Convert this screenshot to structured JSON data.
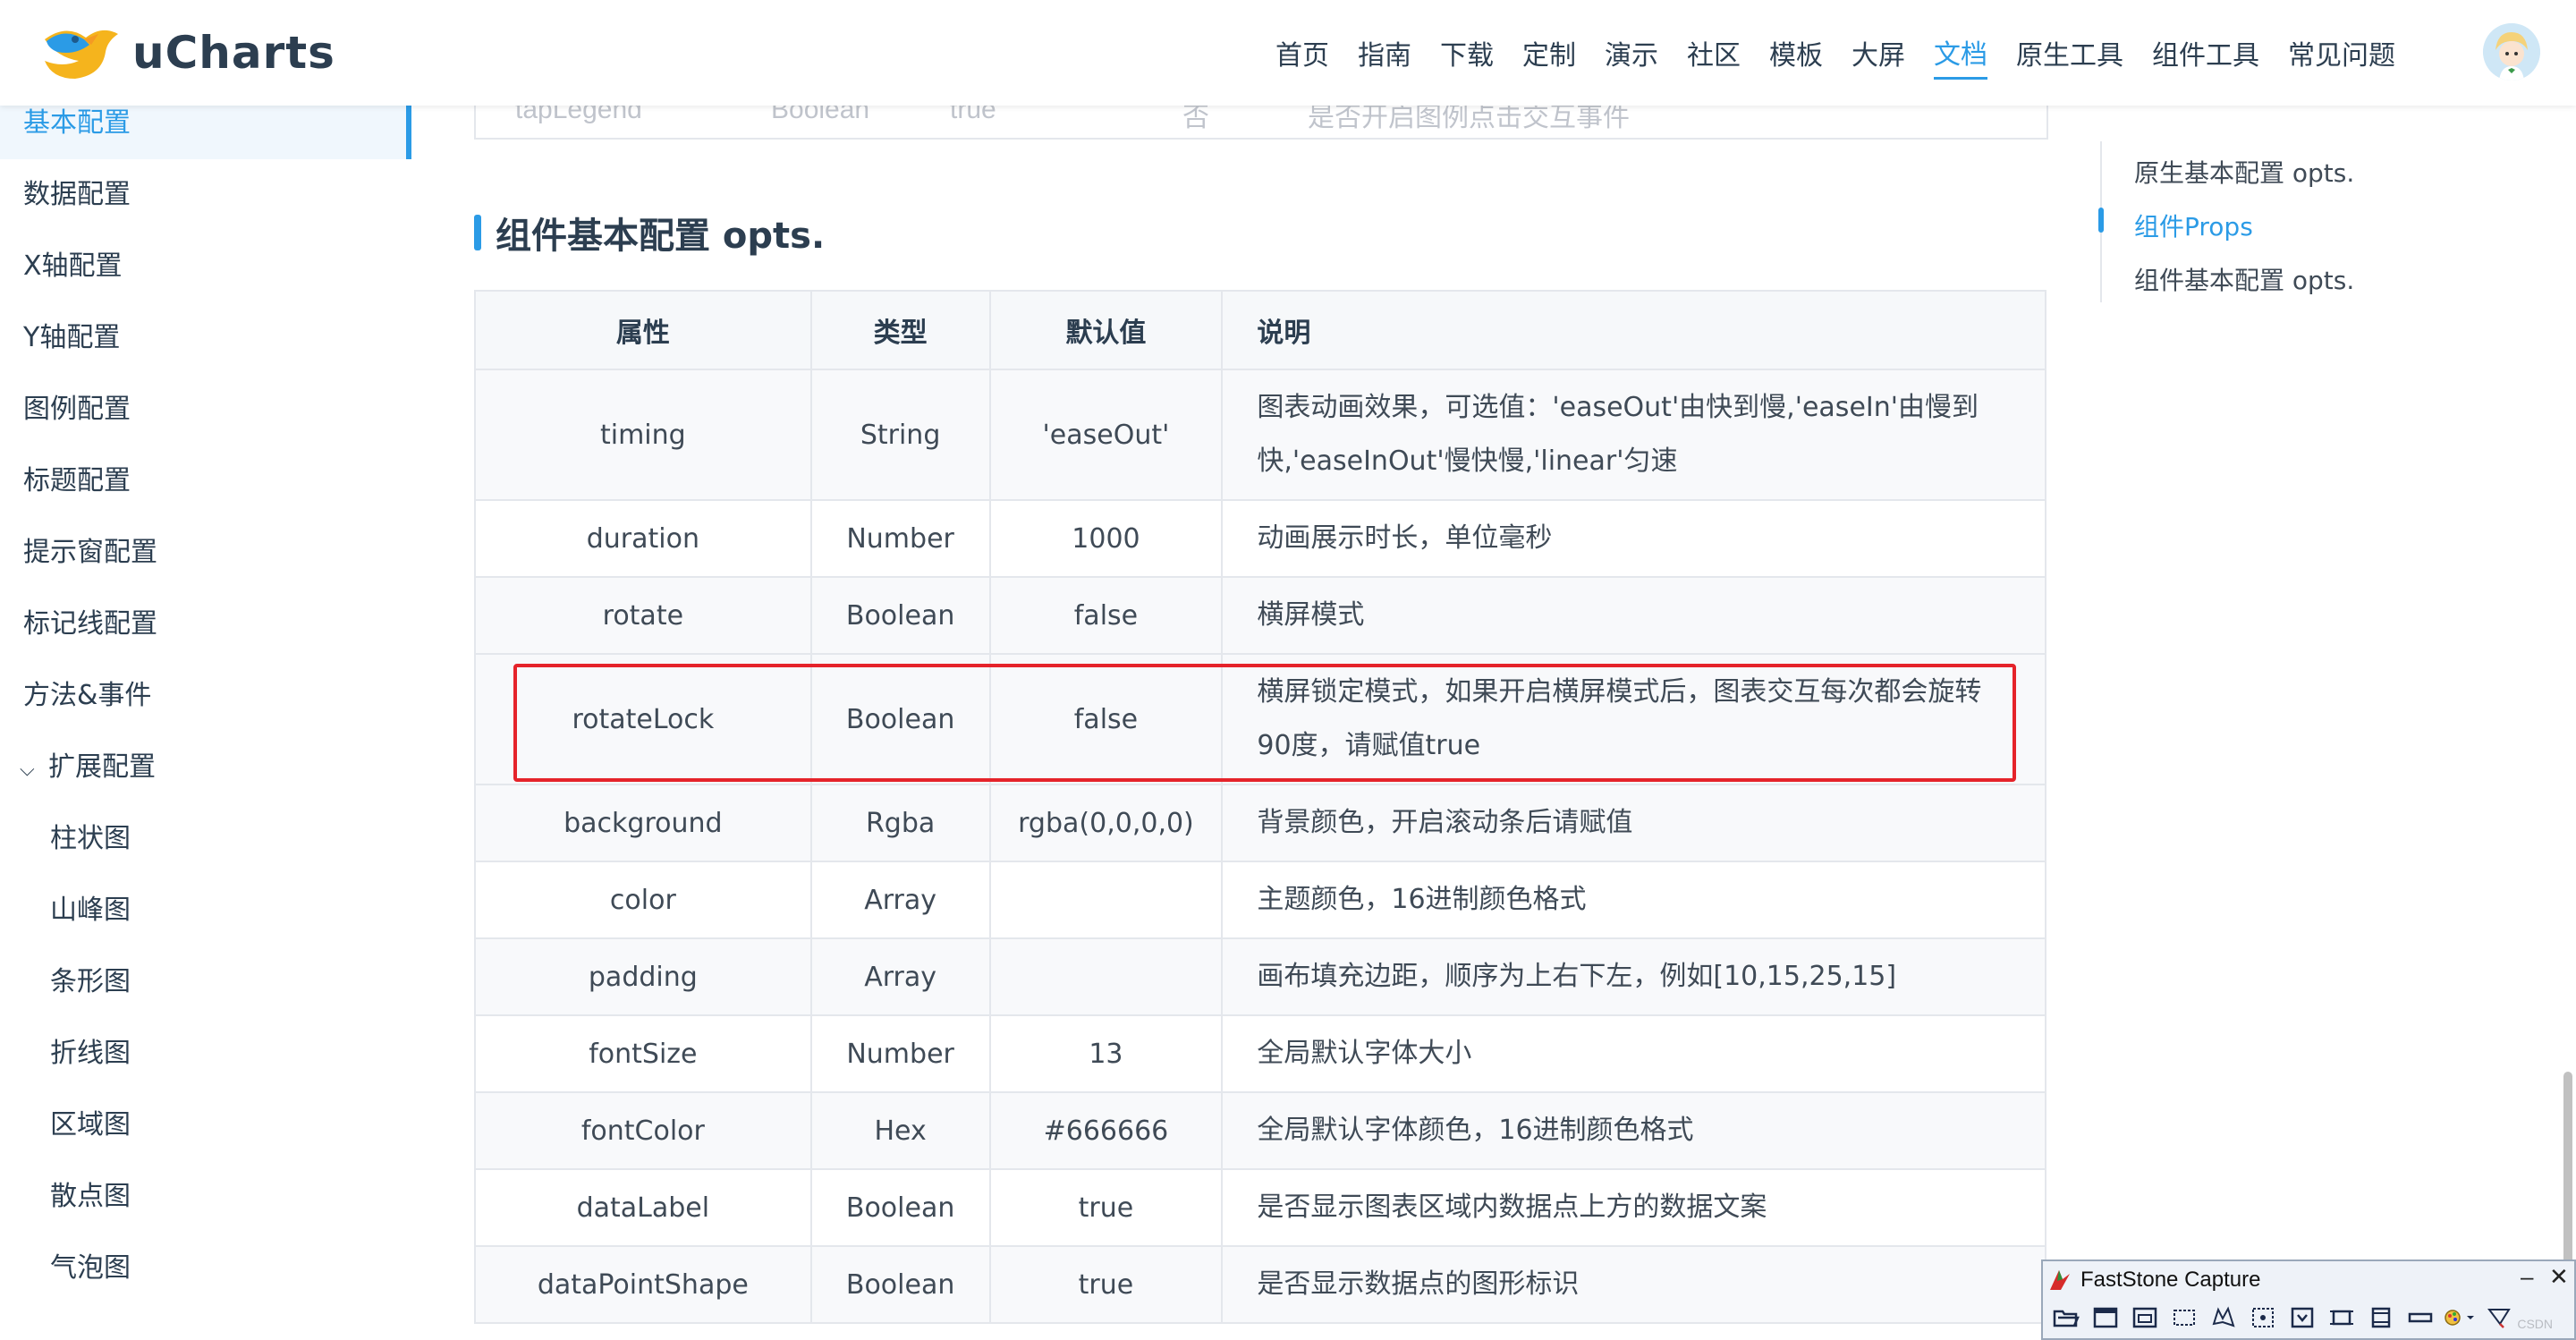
{
  "header": {
    "logo_text": "uCharts",
    "nav": [
      {
        "label": "首页"
      },
      {
        "label": "指南"
      },
      {
        "label": "下载"
      },
      {
        "label": "定制"
      },
      {
        "label": "演示"
      },
      {
        "label": "社区"
      },
      {
        "label": "模板"
      },
      {
        "label": "大屏"
      },
      {
        "label": "文档",
        "active": true
      },
      {
        "label": "原生工具"
      },
      {
        "label": "组件工具"
      },
      {
        "label": "常见问题"
      }
    ]
  },
  "sidebar": {
    "items": [
      {
        "label": "基本配置",
        "active": true
      },
      {
        "label": "数据配置"
      },
      {
        "label": "X轴配置"
      },
      {
        "label": "Y轴配置"
      },
      {
        "label": "图例配置"
      },
      {
        "label": "标题配置"
      },
      {
        "label": "提示窗配置"
      },
      {
        "label": "标记线配置"
      },
      {
        "label": "方法&事件"
      },
      {
        "label": "扩展配置",
        "expanded": true
      },
      {
        "label": "柱状图",
        "sub": true
      },
      {
        "label": "山峰图",
        "sub": true
      },
      {
        "label": "条形图",
        "sub": true
      },
      {
        "label": "折线图",
        "sub": true
      },
      {
        "label": "区域图",
        "sub": true
      },
      {
        "label": "散点图",
        "sub": true
      },
      {
        "label": "气泡图",
        "sub": true
      }
    ]
  },
  "previous_row": {
    "name": "tapLegend",
    "type": "Boolean",
    "default": "true",
    "required": "否",
    "desc": "是否开启图例点击交互事件"
  },
  "section": {
    "title": "组件基本配置 opts."
  },
  "table": {
    "headers": {
      "attr": "属性",
      "type": "类型",
      "default": "默认值",
      "desc": "说明"
    },
    "rows": [
      {
        "attr": "timing",
        "type": "String",
        "default": "'easeOut'",
        "desc": "图表动画效果，可选值：'easeOut'由快到慢,'easeIn'由慢到快,'easeInOut'慢快慢,'linear'匀速"
      },
      {
        "attr": "duration",
        "type": "Number",
        "default": "1000",
        "desc": "动画展示时长，单位毫秒"
      },
      {
        "attr": "rotate",
        "type": "Boolean",
        "default": "false",
        "desc": "横屏模式"
      },
      {
        "attr": "rotateLock",
        "type": "Boolean",
        "default": "false",
        "desc": "横屏锁定模式，如果开启横屏模式后，图表交互每次都会旋转90度，请赋值true"
      },
      {
        "attr": "background",
        "type": "Rgba",
        "default": "rgba(0,0,0,0)",
        "desc": "背景颜色，开启滚动条后请赋值"
      },
      {
        "attr": "color",
        "type": "Array",
        "default": "",
        "desc": "主题颜色，16进制颜色格式"
      },
      {
        "attr": "padding",
        "type": "Array",
        "default": "",
        "desc": "画布填充边距，顺序为上右下左，例如[10,15,25,15]"
      },
      {
        "attr": "fontSize",
        "type": "Number",
        "default": "13",
        "desc": "全局默认字体大小"
      },
      {
        "attr": "fontColor",
        "type": "Hex",
        "default": "#666666",
        "desc": "全局默认字体颜色，16进制颜色格式"
      },
      {
        "attr": "dataLabel",
        "type": "Boolean",
        "default": "true",
        "desc": "是否显示图表区域内数据点上方的数据文案"
      },
      {
        "attr": "dataPointShape",
        "type": "Boolean",
        "default": "true",
        "desc": "是否显示数据点的图形标识"
      }
    ]
  },
  "toc": {
    "items": [
      {
        "label": "原生基本配置 opts."
      },
      {
        "label": "组件Props",
        "active": true
      },
      {
        "label": "组件基本配置 opts."
      }
    ]
  },
  "faststone": {
    "title": "FastStone Capture"
  },
  "colors": {
    "accent": "#2b9be6",
    "highlight": "#e5232a",
    "text": "#2c3e50"
  }
}
